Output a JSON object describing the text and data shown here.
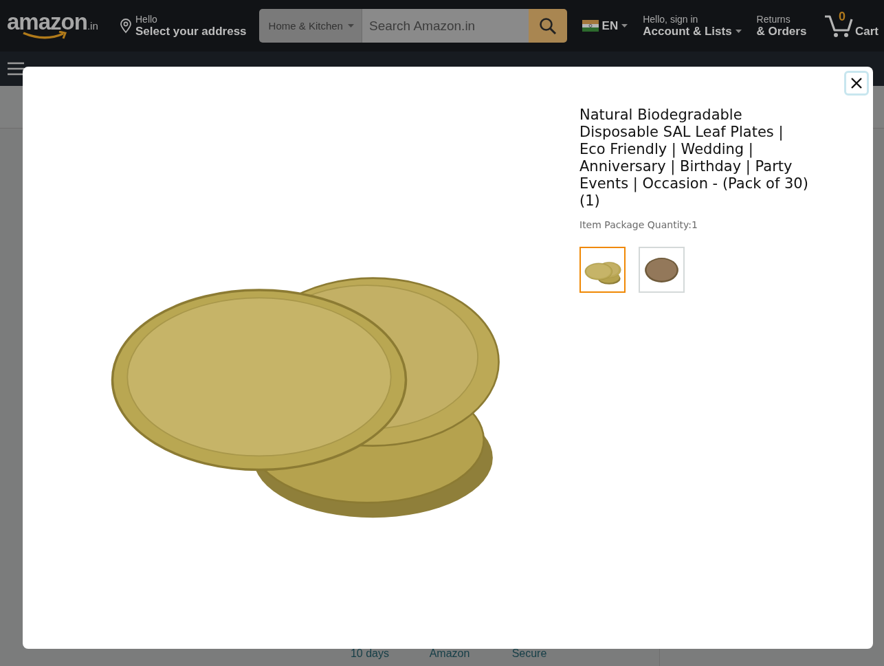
{
  "header": {
    "logo": {
      "wordmark": "amazon",
      "suffix": ".in"
    },
    "address": {
      "greeting": "Hello",
      "label": "Select your address"
    },
    "search": {
      "category": "Home & Kitchen",
      "placeholder": "Search Amazon.in"
    },
    "language": "EN",
    "account": {
      "greeting": "Hello, sign in",
      "label": "Account & Lists"
    },
    "orders": {
      "greeting": "Returns",
      "label": "& Orders"
    },
    "cart": {
      "count": "0",
      "label": "Cart"
    }
  },
  "background_features": [
    "10 days",
    "Amazon",
    "Secure"
  ],
  "image_viewer": {
    "title": "Natural Biodegradable Disposable SAL Leaf Plates | Eco Friendly | Wedding | Anniversary | Birthday | Party Events | Occasion - (Pack of 30) (1)",
    "package_quantity": "Item Package Quantity:1",
    "thumbnails": [
      {
        "kind": "stack",
        "selected": true
      },
      {
        "kind": "single",
        "selected": false
      }
    ]
  }
}
